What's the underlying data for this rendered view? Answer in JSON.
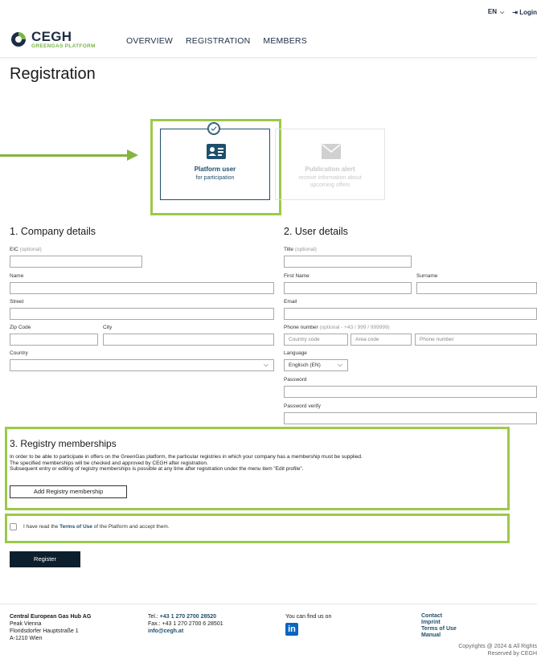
{
  "topbar": {
    "lang": "EN",
    "login": "Login"
  },
  "header": {
    "logo_main": "CEGH",
    "logo_sub": "GREENGAS PLATFORM",
    "nav": [
      "OVERVIEW",
      "REGISTRATION",
      "MEMBERS"
    ]
  },
  "page_title": "Registration",
  "roles": {
    "platform": {
      "title": "Platform user",
      "subtitle": "for participation"
    },
    "alert": {
      "title": "Publication alert",
      "subtitle": "receive information about upcoming offers"
    }
  },
  "company": {
    "title": "1. Company details",
    "eic_label": "EIC",
    "eic_opt": "(optional)",
    "name_label": "Name",
    "street_label": "Street",
    "zip_label": "Zip Code",
    "city_label": "City",
    "country_label": "Country"
  },
  "user": {
    "title": "2. User details",
    "title_label": "Title",
    "title_opt": "(optional)",
    "first_label": "First Name",
    "surname_label": "Surname",
    "email_label": "Email",
    "phone_label": "Phone number",
    "phone_opt": "(optional - +43 / 999 / 999999)",
    "country_code_ph": "Country code",
    "area_code_ph": "Area code",
    "phone_number_ph": "Phone number",
    "language_label": "Language",
    "language_value": "Englisch (EN)",
    "password_label": "Password",
    "password_verify_label": "Password verify"
  },
  "registry": {
    "title": "3. Registry memberships",
    "line1": "In order to be able to participate in offers on the GreenGas platform, the particular registries in which your company has a membership must be supplied.",
    "line2": "The specified memberships will be checked and approved by CEGH after registration.",
    "line3": "Subsequent entry or editing of registry memberships is possible at any time after registration under the menu item \"Edit profile\".",
    "button": "Add Registry membership"
  },
  "terms": {
    "pre": "I have read the ",
    "link": "Terms of Use",
    "post": " of the Platform and accept them."
  },
  "register_button": "Register",
  "footer": {
    "company": "Central European Gas Hub AG",
    "addr1": "Peak Vienna",
    "addr2": "Floridsdorfer Hauptstraße 1",
    "addr3": "A-1210 Wien",
    "tel_label": "Tel.: ",
    "tel": "+43 1 270 2700 28520",
    "fax": "Fax.: +43 1 270 2700 6 28501",
    "email": "info@cegh.at",
    "find_us": "You can find us on",
    "social_icon": "in",
    "links": [
      "Contact",
      "Imprint",
      "Terms of Use",
      "Manual"
    ],
    "copyright1": "Copyrights @ 2024 & All Rights",
    "copyright2": "Reserved by CEGH"
  },
  "colors": {
    "accent": "#9cc94a",
    "brand": "#1f4f6c",
    "dark": "#0d1f2d"
  }
}
